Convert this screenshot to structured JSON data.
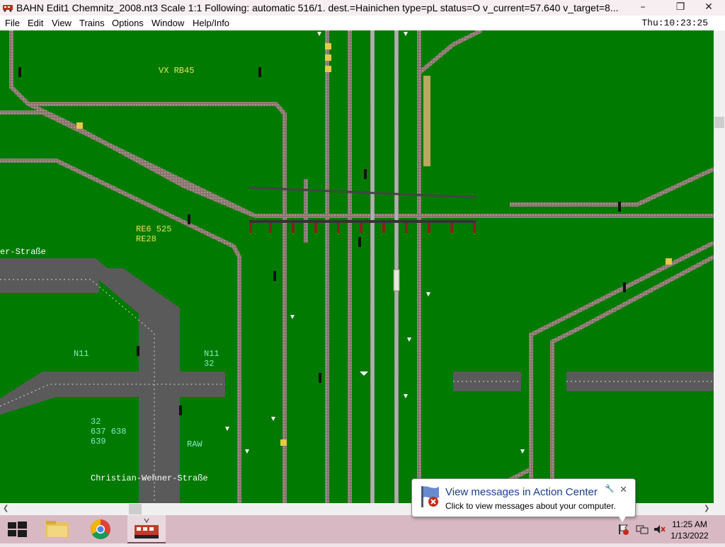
{
  "window": {
    "title": "BAHN Edit1 Chemnitz_2008.nt3 Scale 1:1 Following: automatic 516/1.  dest.=Hainichen type=pL status=O  v_current=57.640 v_target=8...",
    "minimize": "–",
    "restore": "❐",
    "close": "✕"
  },
  "menu": {
    "items": [
      "File",
      "Edit",
      "View",
      "Trains",
      "Options",
      "Window",
      "Help/Info"
    ],
    "clock": "Thu:10:23:25"
  },
  "map": {
    "labels": [
      {
        "text": "VX RB45",
        "color": "yellow"
      },
      {
        "text": "RE6 525\nRE28",
        "color": "yellow"
      },
      {
        "text": "er-Straße",
        "color": "white"
      },
      {
        "text": "N11",
        "color": "cyan"
      },
      {
        "text": "N11\n32",
        "color": "cyan"
      },
      {
        "text": "32\n637 638\n639",
        "color": "cyan"
      },
      {
        "text": "RAW",
        "color": "cyan"
      },
      {
        "text": "Christian-Wehner-Straße",
        "color": "white"
      }
    ],
    "colors": {
      "background": "#007a00",
      "track": "#8a7470",
      "road": "#5a5a5a",
      "station_label": "#e6e65a",
      "line_label": "#7ff0c8"
    }
  },
  "notification": {
    "title": "View messages in Action Center",
    "text": "Click to view messages about your computer."
  },
  "taskbar": {
    "time": "11:25 AM",
    "date": "1/13/2022"
  }
}
